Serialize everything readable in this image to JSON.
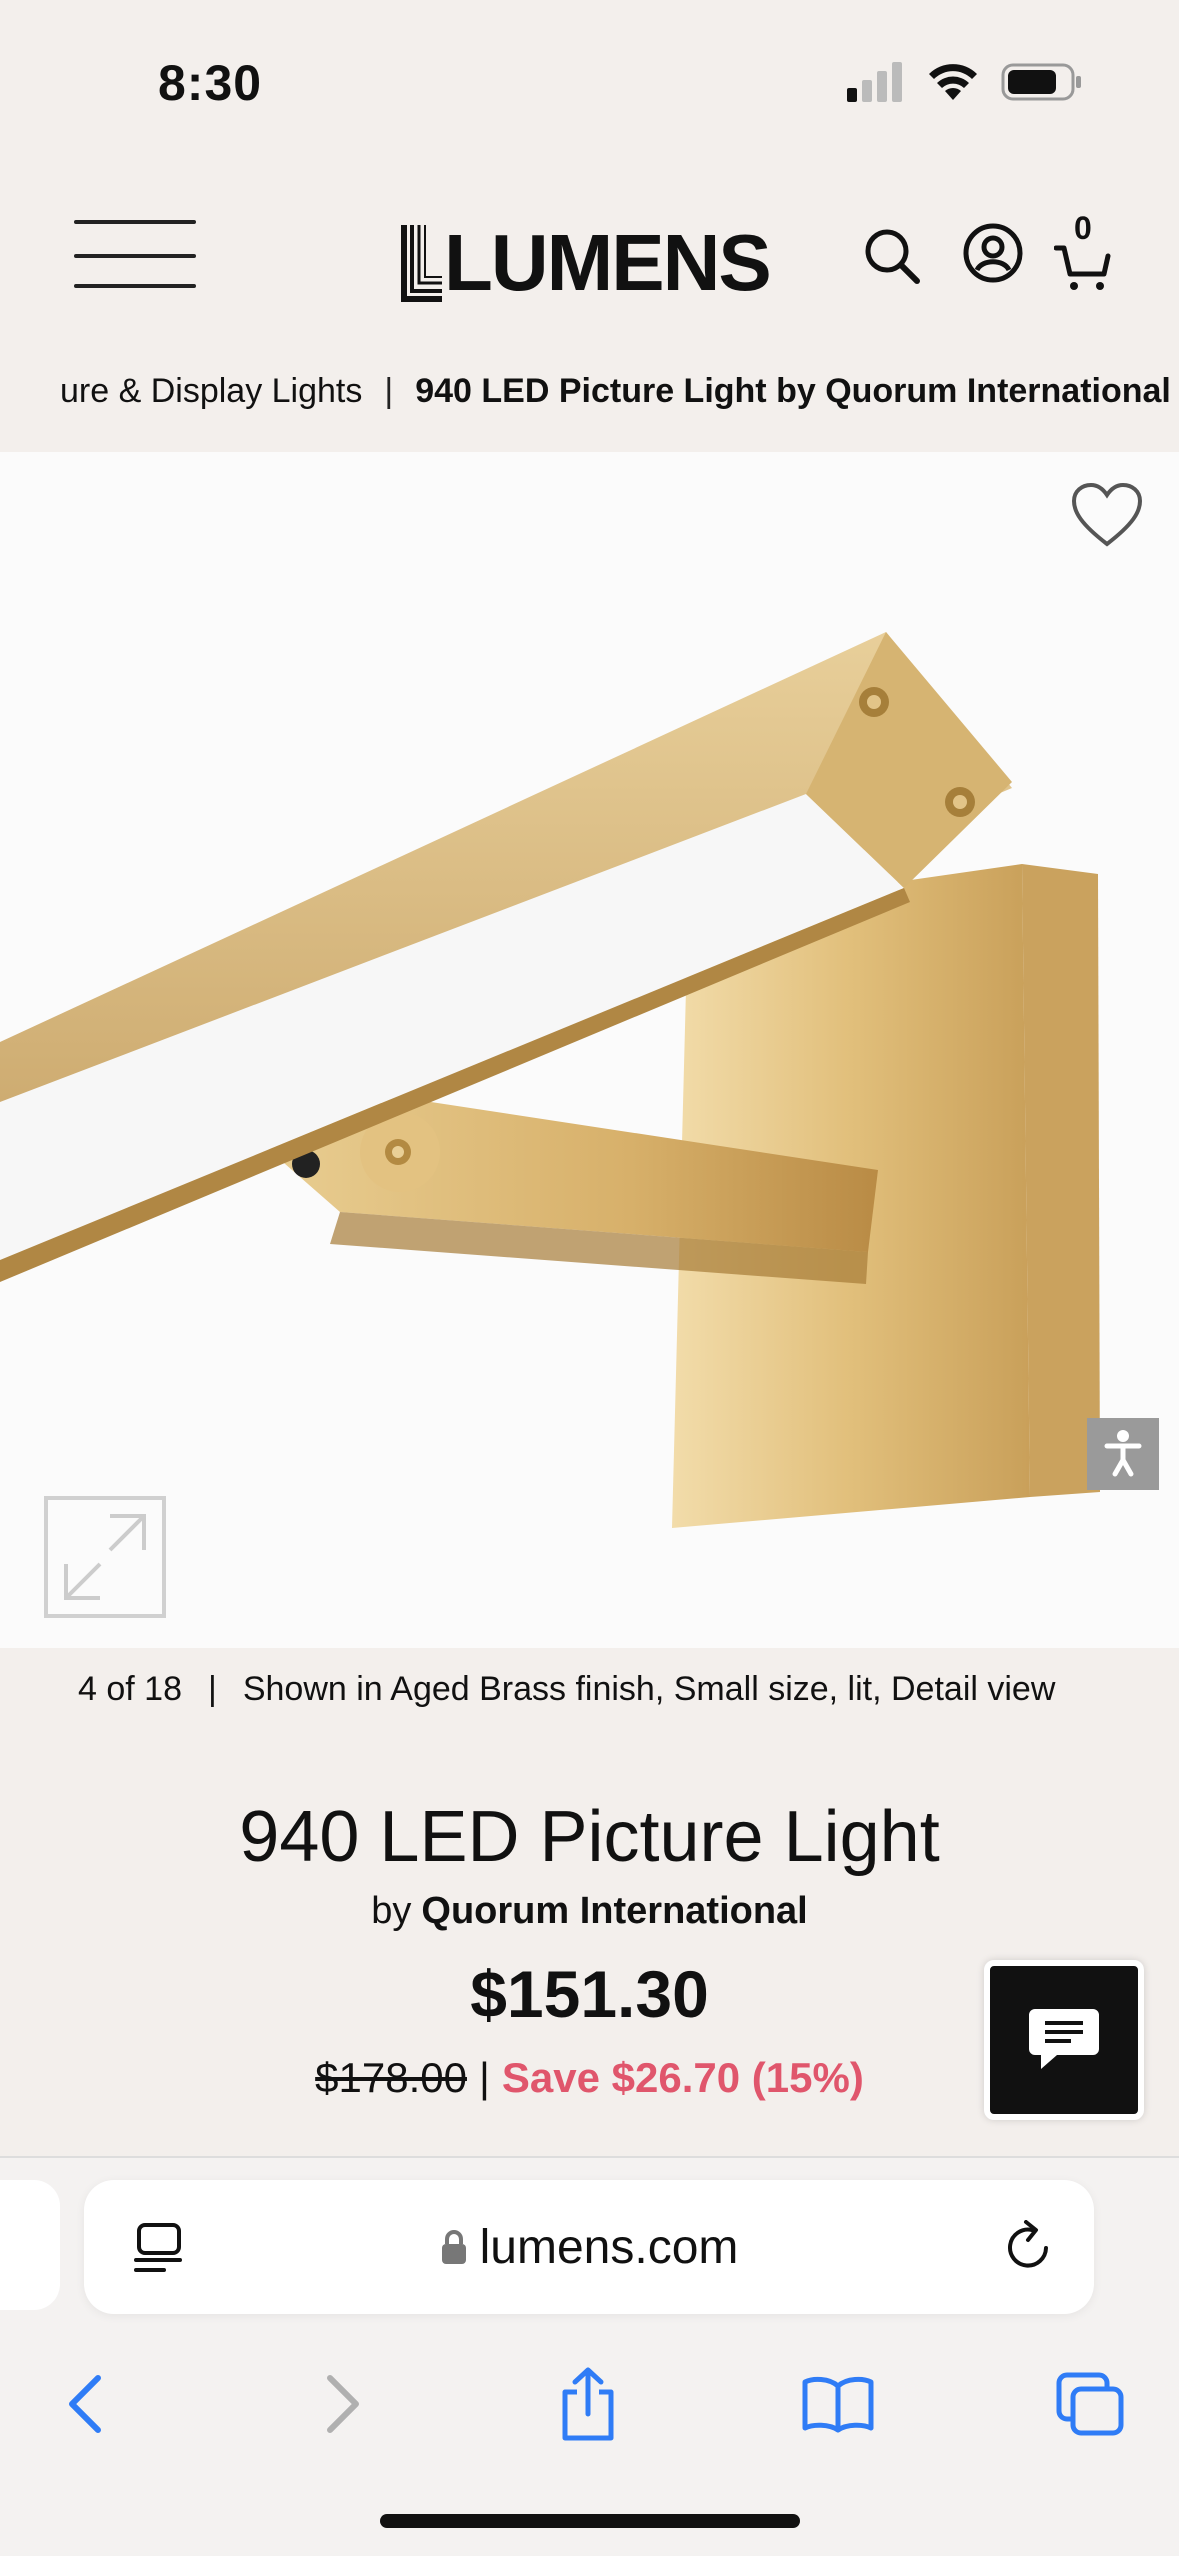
{
  "status_bar": {
    "time": "8:30",
    "icons": [
      "cellular-signal-icon",
      "wifi-icon",
      "battery-icon"
    ]
  },
  "header": {
    "logo_text": "LUMENS",
    "icons": [
      "menu-icon",
      "search-icon",
      "account-icon",
      "cart-icon"
    ],
    "cart_count": "0"
  },
  "breadcrumb": {
    "parent": "ure & Display Lights",
    "separator": "|",
    "current": "940 LED Picture Light by Quorum International"
  },
  "image": {
    "icons": [
      "heart-icon",
      "expand-icon",
      "accessibility-icon"
    ]
  },
  "caption": {
    "position": "4 of 18",
    "separator": "|",
    "description": "Shown in Aged Brass finish, Small size, lit, Detail view"
  },
  "product": {
    "title": "940 LED Picture Light",
    "by": "by",
    "brand": "Quorum International",
    "price": "$151.30",
    "original_price": "$178.00",
    "price_separator": "|",
    "savings": "Save $26.70 (15%)"
  },
  "chat": {
    "icon": "chat-bubble-icon"
  },
  "browser": {
    "url": "lumens.com",
    "icons": [
      "reader-icon",
      "lock-icon",
      "reload-icon",
      "back-icon",
      "forward-icon",
      "share-icon",
      "bookmarks-icon",
      "tabs-icon"
    ]
  },
  "colors": {
    "page_background": "#f3efec",
    "sale_red": "#e0566c",
    "ios_blue": "#2f7cf6",
    "brass": "#d9b97a"
  }
}
